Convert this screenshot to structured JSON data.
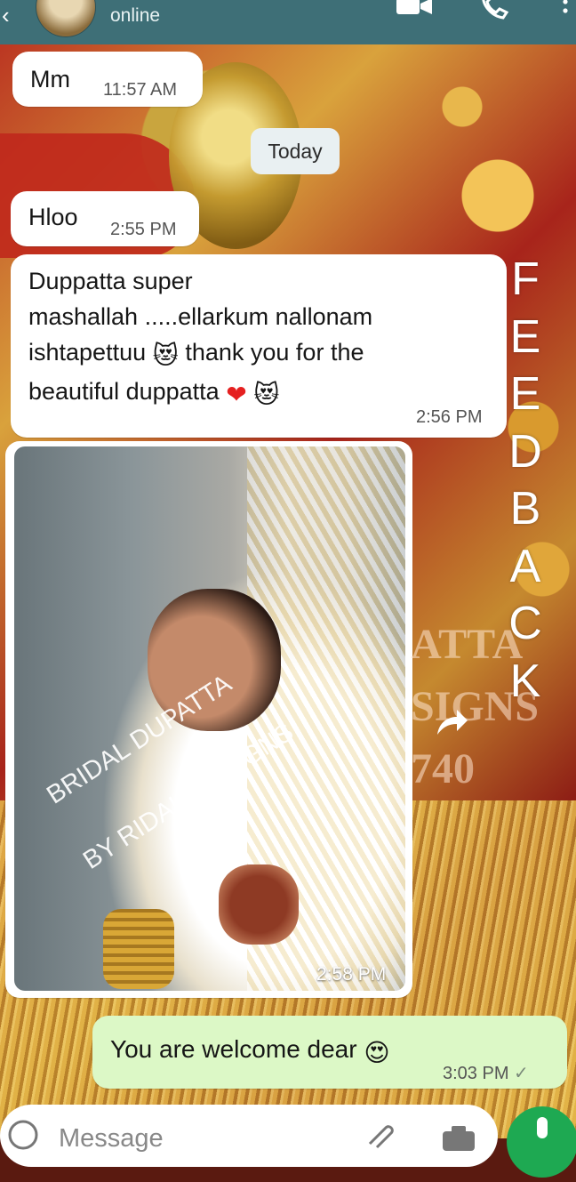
{
  "header": {
    "status": "online"
  },
  "messages": [
    {
      "text": "Mm",
      "time": "11:57 AM"
    },
    {
      "date_chip": "Today"
    },
    {
      "text": "Hloo",
      "time": "2:55 PM"
    },
    {
      "line1": "Duppatta super",
      "line2": "mashallah .....ellarkum nallonam",
      "line3a": "ishtapettuu",
      "line3b": "thank you for the",
      "line4": "beautiful duppatta",
      "emoji_cat": "😻",
      "emoji_heart": "❤",
      "time": "2:56 PM"
    },
    {
      "image_caption_line1": "BRIDAL DUPATTA",
      "image_caption_line2": "BY RIDAH DESIGNS",
      "time": "2:58 PM"
    },
    {
      "text": "You are welcome dear",
      "emoji": "😍",
      "time": "3:03 PM",
      "tick": "✓"
    }
  ],
  "overlay_word": [
    "F",
    "E",
    "E",
    "D",
    "B",
    "A",
    "C",
    "K"
  ],
  "background_text": [
    "ATTA",
    "SIGNS",
    "740"
  ],
  "composer": {
    "placeholder": "Message"
  },
  "colors": {
    "header": "#3e6f77",
    "outgoing_bubble": "#dcf8c6",
    "mic_button": "#1ea952"
  },
  "icons": [
    "back-icon",
    "video-call-icon",
    "voice-call-icon",
    "menu-icon",
    "forward-icon",
    "emoji-icon",
    "attach-icon",
    "camera-icon",
    "mic-icon"
  ]
}
